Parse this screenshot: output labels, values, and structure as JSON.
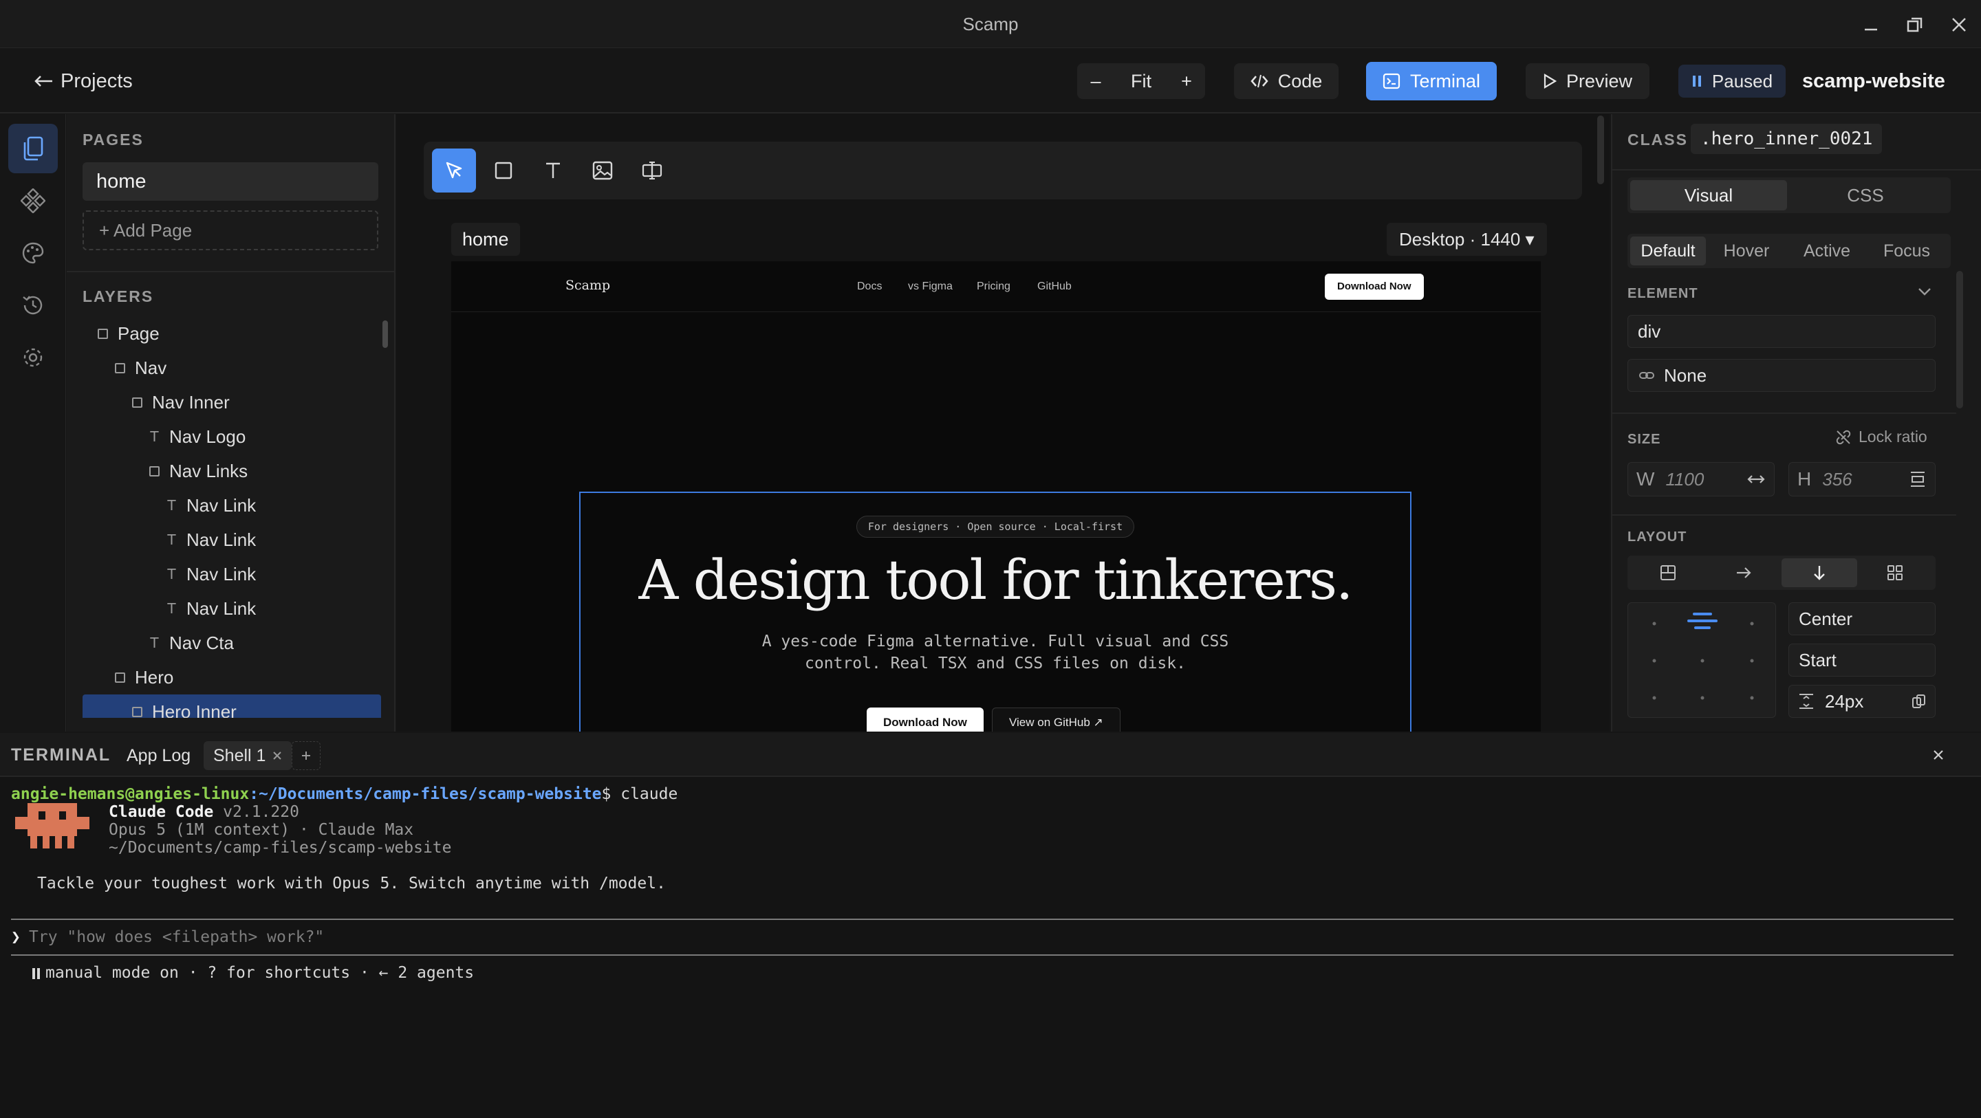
{
  "window": {
    "title": "Scamp"
  },
  "toolbar": {
    "back_label": "Projects",
    "zoom_out": "–",
    "zoom_fit": "Fit",
    "zoom_in": "+",
    "code_label": "Code",
    "terminal_label": "Terminal",
    "preview_label": "Preview",
    "paused_label": "Paused",
    "project_name": "scamp-website"
  },
  "pages": {
    "heading": "PAGES",
    "items": [
      "home"
    ],
    "add_label": "+ Add Page"
  },
  "layers": {
    "heading": "LAYERS",
    "items": [
      {
        "label": "Page",
        "kind": "box",
        "depth": 0
      },
      {
        "label": "Nav",
        "kind": "box",
        "depth": 1
      },
      {
        "label": "Nav Inner",
        "kind": "box",
        "depth": 2
      },
      {
        "label": "Nav Logo",
        "kind": "text",
        "depth": 3
      },
      {
        "label": "Nav Links",
        "kind": "box",
        "depth": 3
      },
      {
        "label": "Nav Link",
        "kind": "text",
        "depth": 4
      },
      {
        "label": "Nav Link",
        "kind": "text",
        "depth": 4
      },
      {
        "label": "Nav Link",
        "kind": "text",
        "depth": 4
      },
      {
        "label": "Nav Link",
        "kind": "text",
        "depth": 4
      },
      {
        "label": "Nav Cta",
        "kind": "text",
        "depth": 3
      },
      {
        "label": "Hero",
        "kind": "box",
        "depth": 1
      },
      {
        "label": "Hero Inner",
        "kind": "box",
        "depth": 2,
        "selected": true
      }
    ]
  },
  "canvas": {
    "frame_name": "home",
    "breakpoint": "Desktop · 1440 ▾",
    "site": {
      "logo": "Scamp",
      "links": [
        "Docs",
        "vs Figma",
        "Pricing",
        "GitHub"
      ],
      "cta": "Download Now",
      "badge": "For designers · Open source · Local-first",
      "title": "A design tool for tinkerers.",
      "subtitle_1": "A yes-code Figma alternative. Full visual and CSS",
      "subtitle_2": "control. Real TSX and CSS files on disk.",
      "primary_btn": "Download Now",
      "secondary_btn": "View on GitHub ↗"
    }
  },
  "inspector": {
    "class_label": "CLASS",
    "class_name": ".hero_inner_0021",
    "mode_tabs": [
      "Visual",
      "CSS"
    ],
    "state_tabs": [
      "Default",
      "Hover",
      "Active",
      "Focus"
    ],
    "element_heading": "ELEMENT",
    "element_tag": "div",
    "element_link": "None",
    "size_heading": "SIZE",
    "lock_ratio": "Lock ratio",
    "width_label": "W",
    "width_value": "1100",
    "height_label": "H",
    "height_value": "356",
    "layout_heading": "LAYOUT",
    "align_value": "Center",
    "justify_value": "Start",
    "gap_value": "24px"
  },
  "terminal": {
    "heading": "TERMINAL",
    "tabs": [
      "App Log",
      "Shell 1"
    ],
    "prompt_user": "angie-hemans@angies-linux",
    "prompt_path": ":~/Documents/camp-files/scamp-website",
    "prompt_cmd": "$ claude",
    "app_name": "Claude Code",
    "app_version": " v2.1.220",
    "model_line": "Opus 5 (1M context) · Claude Max",
    "cwd_line": "~/Documents/camp-files/scamp-website",
    "tip_line": "Tackle your toughest work with Opus 5. Switch anytime with /model.",
    "input_placeholder": "Try \"how does <filepath> work?\"",
    "status_line": "manual mode on · ? for shortcuts · ← 2 agents"
  },
  "colors": {
    "accent": "#4a8cf0",
    "selection": "#23407a",
    "terminal_user": "#8fd14f",
    "terminal_path": "#6aa7ff",
    "mascot": "#d97757"
  }
}
